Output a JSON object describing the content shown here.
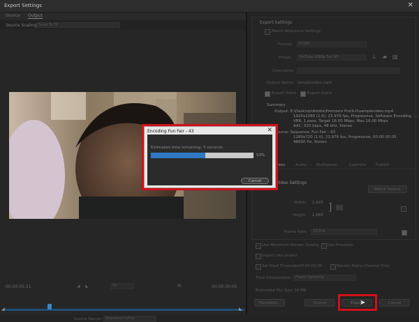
{
  "window": {
    "title": "Export Settings"
  },
  "source_tabs": [
    "Source",
    "Output"
  ],
  "source_scaling": {
    "label": "Source Scaling:",
    "value": "Scale To Fit"
  },
  "timeline": {
    "current_time": "00:00:05:21",
    "end_time": "00:00:30:05",
    "fit": "Fit",
    "source_range_label": "Source Range:",
    "source_range": "Sequence In/Out"
  },
  "export_settings": {
    "heading": "Export Settings",
    "match_sequence": "Match Sequence Settings",
    "format_label": "Format:",
    "format_value": "H.264",
    "preset_label": "Preset:",
    "preset_value": "YouTube 1080p Full HD",
    "comments_label": "Comments:",
    "output_name_label": "Output Name:",
    "output_name_value": "samplevideo.mp4",
    "export_video": "Export Video",
    "export_audio": "Export Audio"
  },
  "summary": {
    "heading": "Summary",
    "output_lines": [
      "Output: E:\\Desktop\\Adobe\\Premiere Pro\\9.0\\samplevideo.mp4",
      "1920x1080 (1.0), 23.976 fps, Progressive, Software Encoding, ...",
      "VBR, 1 pass, Target 16.00 Mbps, Max 16.00 Mbps",
      "AAC, 320 kbps, 48 kHz, Stereo"
    ],
    "source_lines": [
      "Source: Sequence, Fun Fair - 43",
      "1280x720 (1.0), 23.976 fps, Progressive, 00:00:30:05",
      "48000 Hz, Stereo"
    ]
  },
  "settings_tabs": [
    "Video",
    "Audio",
    "Multiplexer",
    "Captions",
    "Publish"
  ],
  "video_settings": {
    "heading": "Basic Video Settings",
    "match_source": "Match Source",
    "width_label": "Width:",
    "width_value": "1,920",
    "height_label": "Height:",
    "height_value": "1,080",
    "frame_rate_label": "Frame Rate:",
    "frame_rate_value": "23.976"
  },
  "bottom_options": {
    "max_render_quality": "Use Maximum Render Quality",
    "use_previews": "Use Previews",
    "import_into_project": "Import into project",
    "set_start_timecode": "Set Start Timecode",
    "start_timecode": "00:00:00:00",
    "render_alpha": "Render Alpha Channel Only",
    "time_interpolation_label": "Time Interpolation:",
    "time_interpolation_value": "Frame Sampling",
    "file_size": "Estimated File Size: 58 MB"
  },
  "buttons": {
    "metadata": "Metadata...",
    "queue": "Queue",
    "export": "Export",
    "cancel": "Cancel"
  },
  "encoding_dialog": {
    "title": "Encoding Fun Fair - 43",
    "close": "✕",
    "estimated": "Estimated time remaining: 5 seconds",
    "percent_label": "53%",
    "progress": 0.53,
    "cancel": "Cancel"
  },
  "colors": {
    "accent_blue": "#2f78c4",
    "highlight_red": "#d2101a"
  }
}
